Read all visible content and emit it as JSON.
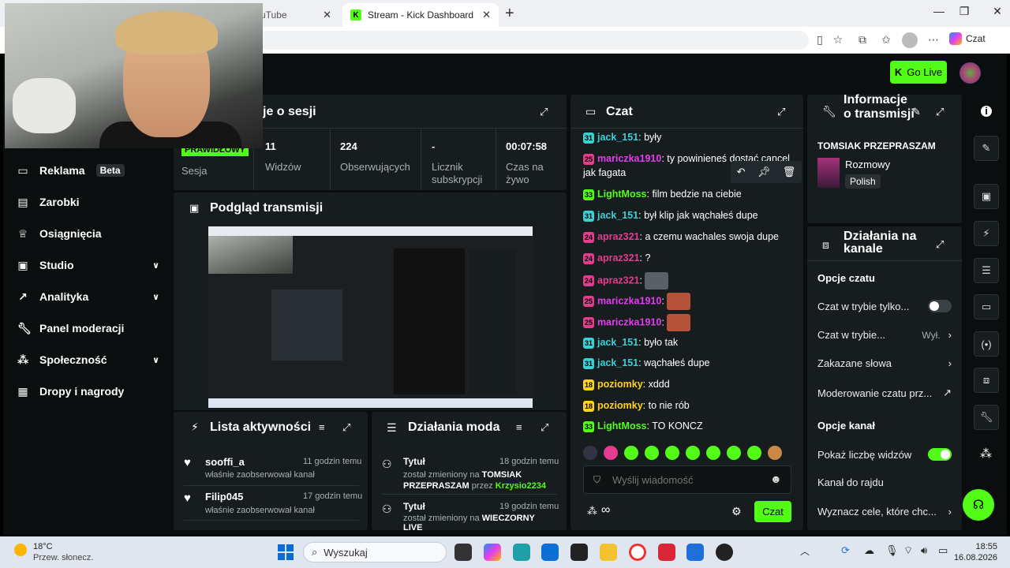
{
  "browser": {
    "tab1_title": "uTube",
    "tab2_title": "Stream - Kick Dashboard",
    "czat_label": "Czat"
  },
  "header": {
    "go_live": "Go Live"
  },
  "sidebar": {
    "items": [
      {
        "label": "Reklama",
        "badge": "Beta",
        "icon": "ad-icon"
      },
      {
        "label": "Zarobki",
        "icon": "chart-icon"
      },
      {
        "label": "Osiągnięcia",
        "icon": "trophy-icon"
      },
      {
        "label": "Studio",
        "icon": "studio-icon"
      },
      {
        "label": "Analityka",
        "icon": "analytics-icon"
      },
      {
        "label": "Panel moderacji",
        "icon": "wrench-icon"
      },
      {
        "label": "Społeczność",
        "icon": "community-icon"
      },
      {
        "label": "Dropy i nagrody",
        "icon": "gift-icon"
      }
    ]
  },
  "session": {
    "title": "je o sesji",
    "badge": "PRAWIDŁOWY",
    "stats": [
      {
        "value": "",
        "label": "Sesja"
      },
      {
        "value": "11",
        "label": "Widzów"
      },
      {
        "value": "224",
        "label": "Obserwujących"
      },
      {
        "value": "-",
        "label": "Licznik subskrypcji"
      },
      {
        "value": "00:07:58",
        "label": "Czas na żywo"
      }
    ]
  },
  "preview": {
    "title": "Podgląd transmisji"
  },
  "activity": {
    "title": "Lista aktywności",
    "items": [
      {
        "user": "sooffi_a",
        "time": "11 godzin temu",
        "text": "właśnie zaobserwował kanał"
      },
      {
        "user": "Filip045",
        "time": "17 godzin temu",
        "text": "właśnie zaobserwował kanał"
      }
    ]
  },
  "modactions": {
    "title": "Działania moda",
    "items": [
      {
        "title": "Tytuł",
        "time": "18 godzin temu",
        "t1": "został zmieniony na ",
        "v1": "TOMSIAK PRZEPRASZAM",
        "t2": " przez ",
        "by": "Krzysio2234"
      },
      {
        "title": "Tytuł",
        "time": "19 godzin temu",
        "t1": "został zmieniony na ",
        "v1": "WIECZORNY LIVE",
        "t2": "",
        "by": ""
      }
    ]
  },
  "chat": {
    "title": "Czat",
    "messages": [
      {
        "badge": "31",
        "user": "jack_151",
        "text": "były",
        "color": "#3ad1d4"
      },
      {
        "badge": "25",
        "user": "mariczka1910",
        "text": "ty powinieneś dostać cancel jak fagata",
        "color": "#e63cf0"
      },
      {
        "badge": "33",
        "user": "LightMoss",
        "text": "film bedzie na ciebie",
        "color": "#53fc18"
      },
      {
        "badge": "31",
        "user": "jack_151",
        "text": "był klip jak wąchałeś dupe",
        "color": "#3ad1d4"
      },
      {
        "badge": "24",
        "user": "apraz321",
        "text": "a czemu wachales swoja dupe",
        "color": "#e63c8f"
      },
      {
        "badge": "24",
        "user": "apraz321",
        "text": "?",
        "color": "#e63c8f"
      },
      {
        "badge": "24",
        "user": "apraz321",
        "text": "",
        "color": "#e63c8f"
      },
      {
        "badge": "25",
        "user": "mariczka1910",
        "text": "",
        "color": "#e63cf0"
      },
      {
        "badge": "25",
        "user": "mariczka1910",
        "text": "",
        "color": "#e63cf0"
      },
      {
        "badge": "31",
        "user": "jack_151",
        "text": "było tak",
        "color": "#3ad1d4"
      },
      {
        "badge": "31",
        "user": "jack_151",
        "text": "wąchałeś dupe",
        "color": "#3ad1d4"
      },
      {
        "badge": "18",
        "user": "poziomky",
        "text": "xddd",
        "color": "#ffd21e"
      },
      {
        "badge": "18",
        "user": "poziomky",
        "text": "to nie rób",
        "color": "#ffd21e"
      },
      {
        "badge": "33",
        "user": "LightMoss",
        "text": "TO KONCZ",
        "color": "#53fc18"
      }
    ],
    "input_placeholder": "Wyślij wiadomość",
    "send_label": "Czat"
  },
  "streaminfo": {
    "title": "Informacje o transmisji",
    "stream_title": "TOMSIAK PRZEPRASZAM",
    "category": "Rozmowy",
    "language": "Polish"
  },
  "channel": {
    "title": "Działania na kanale",
    "chat_options_heading": "Opcje czatu",
    "chat_options": [
      {
        "label": "Czat w trybie tylko..."
      },
      {
        "label": "Czat w trybie...",
        "value": "Wył."
      },
      {
        "label": "Zakazane słowa"
      },
      {
        "label": "Moderowanie czatu prz..."
      }
    ],
    "channel_options_heading": "Opcje kanał",
    "channel_options": [
      {
        "label": "Pokaż liczbę widzów"
      },
      {
        "label": "Kanał do rajdu"
      },
      {
        "label": "Wyznacz cele, które chc..."
      }
    ]
  },
  "taskbar": {
    "temp": "18°C",
    "weather": "Przew. słonecz.",
    "search_placeholder": "Wyszukaj",
    "time": "18:55",
    "date": "16.08.2026"
  },
  "colors": {
    "accent": "#53fc18",
    "panel": "#171c1f",
    "background": "#0b0e0f"
  }
}
